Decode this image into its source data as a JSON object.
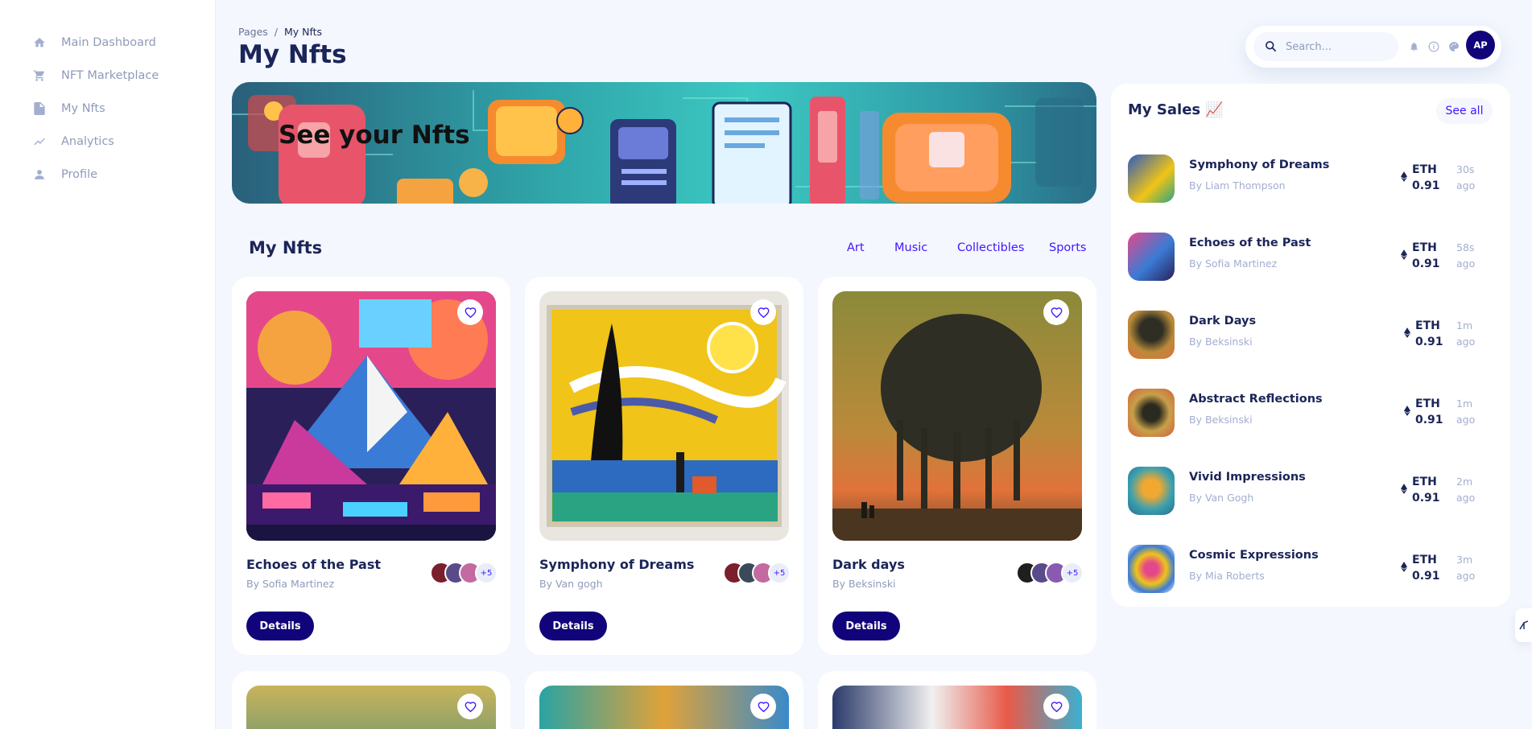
{
  "sidebar": {
    "items": [
      {
        "label": "Main Dashboard",
        "icon": "home-icon"
      },
      {
        "label": "NFT Marketplace",
        "icon": "cart-icon"
      },
      {
        "label": "My Nfts",
        "icon": "document-icon"
      },
      {
        "label": "Analytics",
        "icon": "chart-icon"
      },
      {
        "label": "Profile",
        "icon": "user-icon"
      }
    ]
  },
  "header": {
    "breadcrumb_root": "Pages",
    "breadcrumb_sep": "/",
    "breadcrumb_current": "My Nfts",
    "title": "My Nfts",
    "search_placeholder": "Search...",
    "avatar_initials": "AP"
  },
  "banner": {
    "title": "See your Nfts"
  },
  "nfts": {
    "title": "My Nfts",
    "filters": [
      "Art",
      "Music",
      "Collectibles",
      "Sports"
    ],
    "cards": [
      {
        "name": "Echoes of the Past",
        "author": "By Sofia Martinez",
        "bidders_more": "+5",
        "button": "Details"
      },
      {
        "name": "Symphony of Dreams",
        "author": "By Van gogh",
        "bidders_more": "+5",
        "button": "Details"
      },
      {
        "name": "Dark days",
        "author": "By Beksinski",
        "bidders_more": "+5",
        "button": "Details"
      }
    ]
  },
  "sales": {
    "title": "My Sales 📈",
    "see_all": "See all",
    "items": [
      {
        "name": "Symphony of Dreams",
        "by": "By Liam Thompson",
        "currency": "ETH",
        "price": "0.91",
        "time": "30s",
        "ago": "ago"
      },
      {
        "name": "Echoes of the Past",
        "by": "By Sofia Martinez",
        "currency": "ETH",
        "price": "0.91",
        "time": "58s",
        "ago": "ago"
      },
      {
        "name": "Dark Days",
        "by": "By Beksinski",
        "currency": "ETH",
        "price": "0.91",
        "time": "1m",
        "ago": "ago"
      },
      {
        "name": "Abstract Reflections",
        "by": "By Beksinski",
        "currency": "ETH",
        "price": "0.91",
        "time": "1m",
        "ago": "ago"
      },
      {
        "name": "Vivid Impressions",
        "by": "By Van Gogh",
        "currency": "ETH",
        "price": "0.91",
        "time": "2m",
        "ago": "ago"
      },
      {
        "name": "Cosmic Expressions",
        "by": "By Mia Roberts",
        "currency": "ETH",
        "price": "0.91",
        "time": "3m",
        "ago": "ago"
      }
    ]
  },
  "colors": {
    "brand_navy": "#11047a",
    "accent": "#4318ff",
    "text_primary": "#1b2559",
    "text_muted": "#8f9bba",
    "background": "#f4f7fe"
  }
}
